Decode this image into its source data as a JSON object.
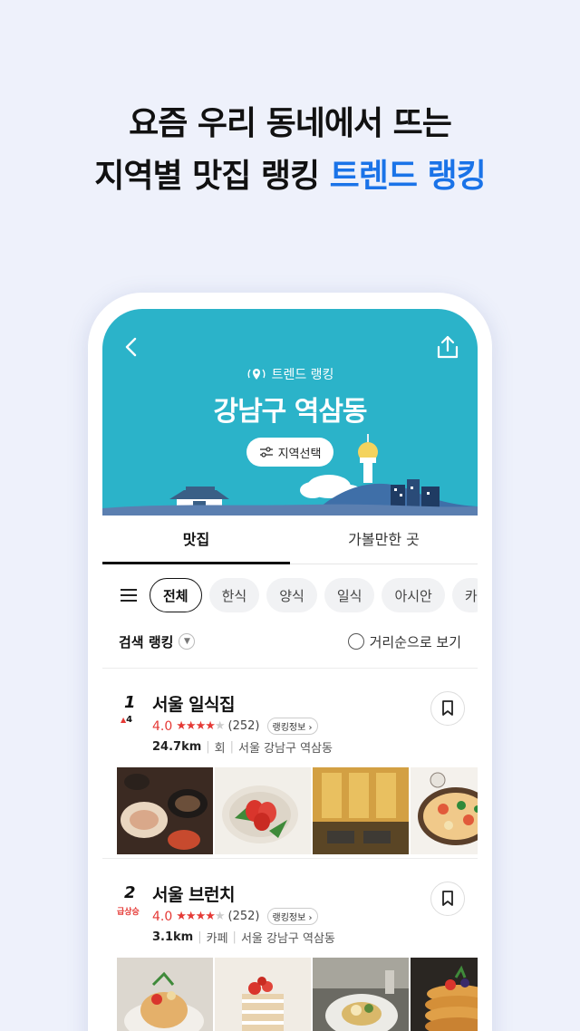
{
  "headline": {
    "line1": "요즘 우리 동네에서 뜨는",
    "line2_plain": "지역별 맛집 랭킹 ",
    "line2_accent": "트렌드 랭킹"
  },
  "header": {
    "badge": "트렌드 랭킹",
    "title": "강남구 역삼동",
    "region_button": "지역선택",
    "background_color": "#2bb3c9"
  },
  "tabs": [
    {
      "label": "맛집",
      "active": true
    },
    {
      "label": "가볼만한 곳",
      "active": false
    }
  ],
  "chips": [
    "전체",
    "한식",
    "양식",
    "일식",
    "아시안",
    "카"
  ],
  "sort": {
    "left_label": "검색 랭킹",
    "right_label": "거리순으로 보기"
  },
  "restaurants": [
    {
      "rank": "1",
      "rank_change": "4",
      "name": "서울 일식집",
      "rating": "4.0",
      "review_count": "(252)",
      "rank_info": "랭킹정보 ›",
      "distance": "24.7km",
      "category": "회",
      "address": "서울 강남구 역삼동"
    },
    {
      "rank": "2",
      "rank_change": "급상승",
      "name": "서울 브런치",
      "rating": "4.0",
      "review_count": "(252)",
      "rank_info": "랭킹정보 ›",
      "distance": "3.1km",
      "category": "카페",
      "address": "서울 강남구 역삼동"
    }
  ],
  "colors": {
    "accent": "#1a73e8",
    "rating": "#e53935"
  }
}
